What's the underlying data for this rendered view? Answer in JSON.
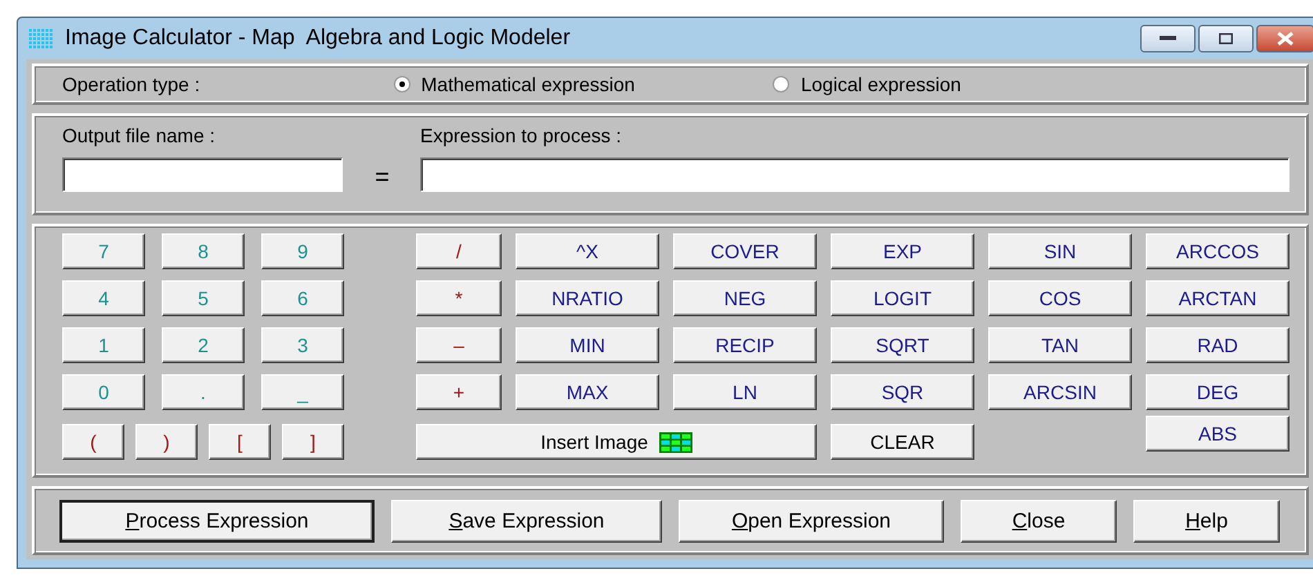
{
  "window": {
    "title": "Image Calculator - Map  Algebra and Logic Modeler"
  },
  "operation_type": {
    "label": "Operation type :",
    "options": [
      {
        "label": "Mathematical expression",
        "selected": true
      },
      {
        "label": "Logical expression",
        "selected": false
      }
    ]
  },
  "output_file": {
    "label": "Output file name :"
  },
  "equals": "=",
  "expression": {
    "label": "Expression to process :"
  },
  "keypad": {
    "digits": [
      {
        "label": "7",
        "kind": "digit"
      },
      {
        "label": "8",
        "kind": "digit"
      },
      {
        "label": "9",
        "kind": "digit"
      },
      {
        "label": "4",
        "kind": "digit"
      },
      {
        "label": "5",
        "kind": "digit"
      },
      {
        "label": "6",
        "kind": "digit"
      },
      {
        "label": "1",
        "kind": "digit"
      },
      {
        "label": "2",
        "kind": "digit"
      },
      {
        "label": "3",
        "kind": "digit"
      },
      {
        "label": "0",
        "kind": "digit"
      },
      {
        "label": ".",
        "kind": "digit"
      },
      {
        "label": "_",
        "kind": "digit"
      }
    ],
    "brackets": [
      {
        "label": "(",
        "kind": "operator"
      },
      {
        "label": ")",
        "kind": "operator"
      },
      {
        "label": "[",
        "kind": "operator"
      },
      {
        "label": "]",
        "kind": "operator"
      }
    ],
    "functions": [
      {
        "label": "/",
        "kind": "operator"
      },
      {
        "label": "^X",
        "kind": "function"
      },
      {
        "label": "COVER",
        "kind": "function"
      },
      {
        "label": "EXP",
        "kind": "function"
      },
      {
        "label": "SIN",
        "kind": "function"
      },
      {
        "label": "ARCCOS",
        "kind": "function"
      },
      {
        "label": "*",
        "kind": "operator"
      },
      {
        "label": "NRATIO",
        "kind": "function"
      },
      {
        "label": "NEG",
        "kind": "function"
      },
      {
        "label": "LOGIT",
        "kind": "function"
      },
      {
        "label": "COS",
        "kind": "function"
      },
      {
        "label": "ARCTAN",
        "kind": "function"
      },
      {
        "label": "–",
        "kind": "operator"
      },
      {
        "label": "MIN",
        "kind": "function"
      },
      {
        "label": "RECIP",
        "kind": "function"
      },
      {
        "label": "SQRT",
        "kind": "function"
      },
      {
        "label": "TAN",
        "kind": "function"
      },
      {
        "label": "RAD",
        "kind": "function"
      },
      {
        "label": "+",
        "kind": "operator"
      },
      {
        "label": "MAX",
        "kind": "function"
      },
      {
        "label": "LN",
        "kind": "function"
      },
      {
        "label": "SQR",
        "kind": "function"
      },
      {
        "label": "ARCSIN",
        "kind": "function"
      },
      {
        "label": "DEG",
        "kind": "function"
      }
    ],
    "bottom_row": [
      {
        "label": "Insert Image",
        "kind": "command"
      },
      {
        "label": "CLEAR",
        "kind": "command"
      },
      {
        "label": "ABS",
        "kind": "function"
      }
    ]
  },
  "actions": [
    {
      "accel": "P",
      "rest": "rocess Expression",
      "default": true
    },
    {
      "accel": "S",
      "rest": "ave Expression",
      "default": false
    },
    {
      "accel": "O",
      "rest": "pen Expression",
      "default": false
    },
    {
      "accel": "C",
      "rest": "lose",
      "default": false
    },
    {
      "accel": "H",
      "rest": "elp",
      "default": false
    }
  ]
}
